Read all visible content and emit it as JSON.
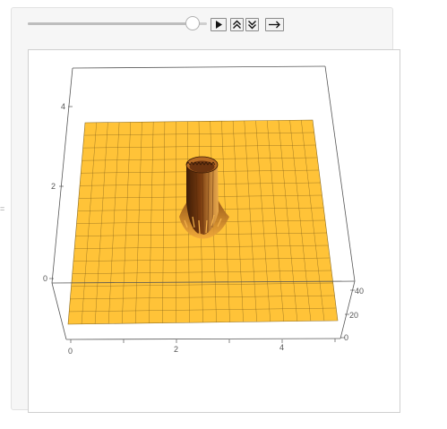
{
  "side_label": "=",
  "controls": {
    "slider_value": 0.92,
    "play_button": "play-icon",
    "faster_button": "double-chevron-up-icon",
    "slower_button": "double-chevron-down-icon",
    "direction_button": "right-arrow-icon"
  },
  "plot": {
    "z_ticks": [
      "0",
      "2",
      "4"
    ],
    "x_ticks": [
      "0",
      "2",
      "4"
    ],
    "y_ticks": [
      "0",
      "20",
      "40"
    ],
    "surface_color": "#FFC338",
    "spike_color": "#7A3C10"
  }
}
